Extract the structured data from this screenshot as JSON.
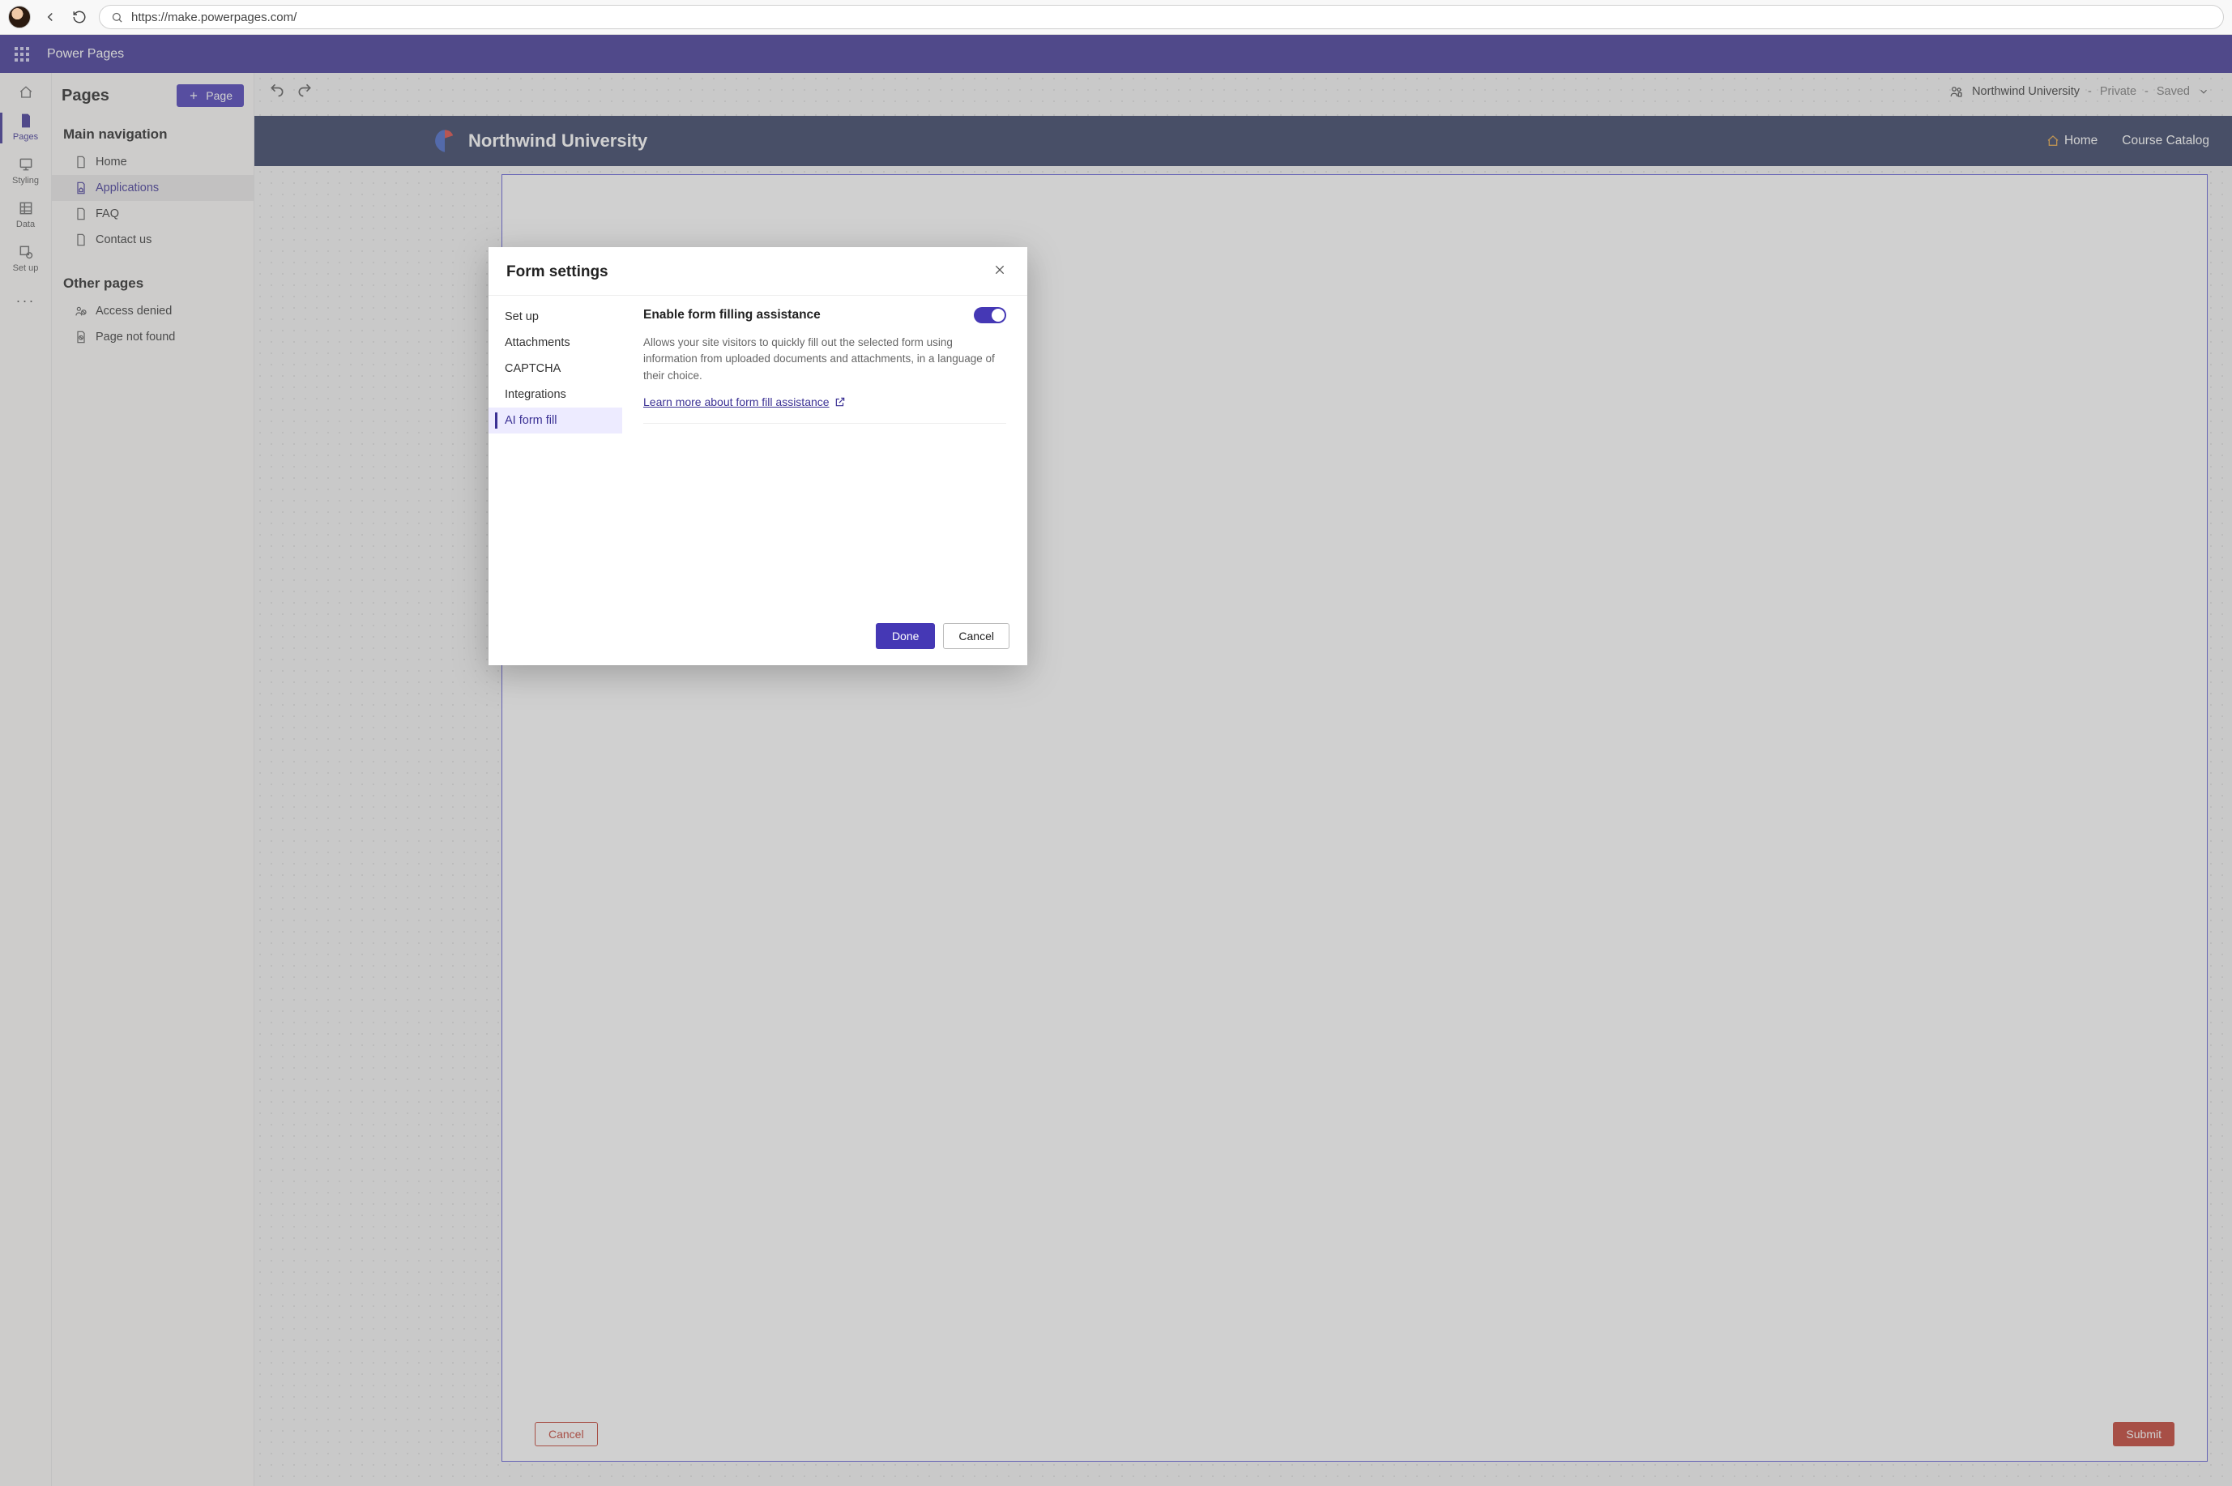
{
  "browser": {
    "url": "https://make.powerpages.com/"
  },
  "app": {
    "name": "Power Pages"
  },
  "rail": {
    "items": [
      {
        "key": "pages",
        "label": "Pages"
      },
      {
        "key": "styling",
        "label": "Styling"
      },
      {
        "key": "data",
        "label": "Data"
      },
      {
        "key": "setup",
        "label": "Set up"
      }
    ]
  },
  "sidePanel": {
    "title": "Pages",
    "addPageLabel": "Page",
    "sections": [
      {
        "title": "Main navigation",
        "items": [
          {
            "key": "home",
            "label": "Home"
          },
          {
            "key": "applications",
            "label": "Applications"
          },
          {
            "key": "faq",
            "label": "FAQ"
          },
          {
            "key": "contact",
            "label": "Contact us"
          }
        ]
      },
      {
        "title": "Other pages",
        "items": [
          {
            "key": "access-denied",
            "label": "Access denied"
          },
          {
            "key": "not-found",
            "label": "Page not found"
          }
        ]
      }
    ]
  },
  "canvas": {
    "siteName": "Northwind University",
    "visibility": "Private",
    "saveState": "Saved",
    "nav": {
      "home": "Home",
      "catalog": "Course Catalog"
    },
    "formButtons": {
      "cancel": "Cancel",
      "submit": "Submit"
    }
  },
  "dialog": {
    "title": "Form settings",
    "nav": [
      {
        "key": "setup",
        "label": "Set up"
      },
      {
        "key": "attachments",
        "label": "Attachments"
      },
      {
        "key": "captcha",
        "label": "CAPTCHA"
      },
      {
        "key": "integrations",
        "label": "Integrations"
      },
      {
        "key": "aiformfill",
        "label": "AI form fill"
      }
    ],
    "content": {
      "toggleLabel": "Enable form filling assistance",
      "toggleValue": true,
      "description": "Allows your site visitors to quickly fill out the selected form using information from uploaded documents and attachments, in a language of their choice.",
      "learnMore": "Learn more about form fill assistance"
    },
    "buttons": {
      "done": "Done",
      "cancel": "Cancel"
    }
  }
}
